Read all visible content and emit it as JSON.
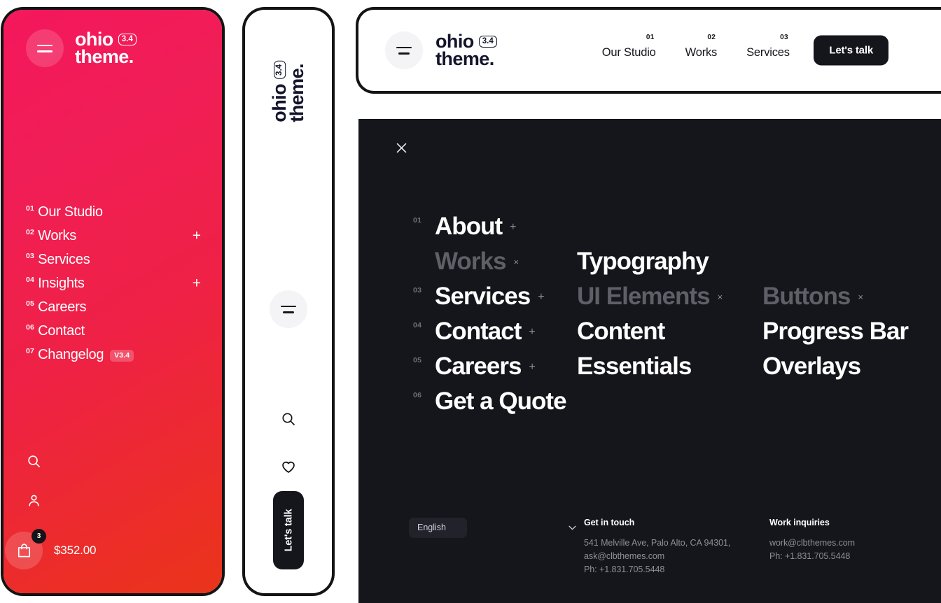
{
  "brand": {
    "name_line1": "ohio",
    "name_line2": "theme.",
    "version_badge": "3.4",
    "accent_pink": "#f4175c",
    "accent_orange": "#ea3419",
    "dark": "#15161b"
  },
  "pink_panel": {
    "menu": [
      {
        "num": "01",
        "label": "Our Studio",
        "expand": ""
      },
      {
        "num": "02",
        "label": "Works",
        "expand": "+"
      },
      {
        "num": "03",
        "label": "Services",
        "expand": ""
      },
      {
        "num": "04",
        "label": "Insights",
        "expand": "+"
      },
      {
        "num": "05",
        "label": "Careers",
        "expand": ""
      },
      {
        "num": "06",
        "label": "Contact",
        "expand": ""
      },
      {
        "num": "07",
        "label": "Changelog",
        "expand": "",
        "tag": "V3.4"
      }
    ],
    "cart": {
      "count": "3",
      "total": "$352.00"
    },
    "icons": {
      "search": "search-icon",
      "account": "user-icon",
      "cart": "shopping-bag-icon",
      "menu": "hamburger-icon"
    }
  },
  "slim_panel": {
    "cta_label": "Let's talk",
    "icons": {
      "menu": "hamburger-icon",
      "search": "search-icon",
      "wishlist": "heart-icon"
    }
  },
  "header_bar": {
    "nav": [
      {
        "num": "01",
        "label": "Our Studio"
      },
      {
        "num": "02",
        "label": "Works"
      },
      {
        "num": "03",
        "label": "Services"
      }
    ],
    "cta_label": "Let's talk"
  },
  "dark_panel": {
    "close_label": "close-icon",
    "column_a": [
      {
        "num": "01",
        "label": "About",
        "sign": "+",
        "state": "normal"
      },
      {
        "num": "",
        "label": "Works",
        "sign": "×",
        "state": "dim"
      },
      {
        "num": "03",
        "label": "Services",
        "sign": "+",
        "state": "normal"
      },
      {
        "num": "04",
        "label": "Contact",
        "sign": "+",
        "state": "normal"
      },
      {
        "num": "05",
        "label": "Careers",
        "sign": "+",
        "state": "normal"
      },
      {
        "num": "06",
        "label": "Get a Quote",
        "sign": "",
        "state": "normal"
      }
    ],
    "column_b": [
      {
        "label": "Typography",
        "sign": "",
        "state": "normal"
      },
      {
        "label": "UI Elements",
        "sign": "×",
        "state": "dim"
      },
      {
        "label": "Content",
        "sign": "",
        "state": "normal"
      },
      {
        "label": "Essentials",
        "sign": "",
        "state": "normal"
      }
    ],
    "column_c": [
      {
        "label": "Buttons",
        "sign": "×",
        "state": "dim"
      },
      {
        "label": "Progress Bar",
        "sign": "",
        "state": "normal"
      },
      {
        "label": "Overlays",
        "sign": "",
        "state": "normal"
      }
    ],
    "footer": {
      "language": "English",
      "language_options": [
        "English"
      ],
      "get_in_touch": {
        "title": "Get in touch",
        "line1": "541 Melville Ave, Palo Alto, CA 94301,",
        "line2": "ask@clbthemes.com",
        "line3": "Ph: +1.831.705.5448"
      },
      "work_inquiries": {
        "title": "Work inquiries",
        "line1": "work@clbthemes.com",
        "line2": "Ph: +1.831.705.5448"
      }
    }
  }
}
